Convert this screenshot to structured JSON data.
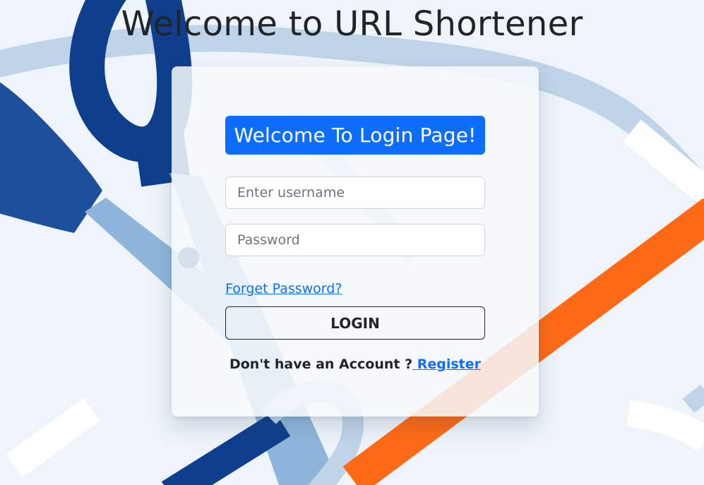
{
  "page": {
    "title": "Welcome to URL Shortener"
  },
  "login_card": {
    "heading": "Welcome To Login Page!",
    "username_placeholder": "Enter username",
    "password_placeholder": "Password",
    "forgot_password_label": "Forget Password?",
    "login_button_label": "LOGIN",
    "register_prompt": "Don't have an Account ?",
    "register_link_label": " Register"
  },
  "theme": {
    "primary": "#0d6efd",
    "text": "#212529",
    "background": "#eef4fa",
    "scissors_dark": "#0f3f8c",
    "scissors_light": "#8fb6da",
    "orange_line": "#ff6a16"
  },
  "background_art": {
    "icon": "scissors-cutting-line-illustration"
  }
}
